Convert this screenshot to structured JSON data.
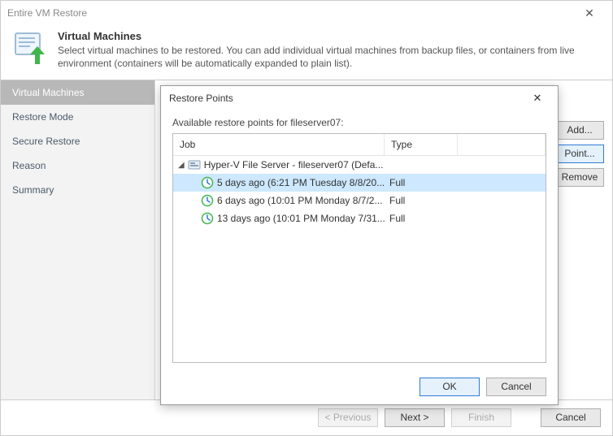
{
  "window": {
    "title": "Entire VM Restore"
  },
  "header": {
    "title": "Virtual Machines",
    "subtitle": "Select virtual machines to be restored. You  can add individual virtual machines from backup files, or containers from live environment (containers will be automatically expanded to plain list)."
  },
  "sidebar": {
    "items": [
      {
        "label": "Virtual Machines",
        "active": true
      },
      {
        "label": "Restore Mode"
      },
      {
        "label": "Secure Restore"
      },
      {
        "label": "Reason"
      },
      {
        "label": "Summary"
      }
    ]
  },
  "actions": {
    "add": "Add...",
    "point": "Point...",
    "remove": "Remove"
  },
  "footer": {
    "previous": "< Previous",
    "next": "Next >",
    "finish": "Finish",
    "cancel": "Cancel"
  },
  "modal": {
    "title": "Restore Points",
    "label": "Available restore points for fileserver07:",
    "columns": {
      "job": "Job",
      "type": "Type"
    },
    "parent": {
      "label": "Hyper-V File Server - fileserver07 (Defa..."
    },
    "rows": [
      {
        "label": "5 days ago (6:21 PM Tuesday 8/8/20...",
        "type": "Full",
        "selected": true
      },
      {
        "label": "6 days ago (10:01 PM Monday 8/7/2...",
        "type": "Full"
      },
      {
        "label": "13 days ago (10:01 PM Monday 7/31...",
        "type": "Full"
      }
    ],
    "ok": "OK",
    "cancel": "Cancel"
  }
}
